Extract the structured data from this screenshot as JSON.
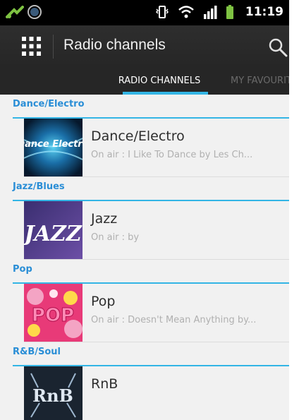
{
  "status_bar": {
    "time": "11:19",
    "icons": [
      "usb-debug-icon",
      "clock-icon",
      "vibrate-icon",
      "wifi-icon",
      "signal-icon",
      "battery-icon"
    ]
  },
  "action_bar": {
    "title": "Radio channels",
    "icons": [
      "app-grid-icon",
      "search-icon"
    ]
  },
  "tabs": [
    {
      "label": "RADIO CHANNELS",
      "selected": true
    },
    {
      "label": "MY FAVOURITES",
      "selected": false
    }
  ],
  "colors": {
    "accent": "#33b5e5",
    "section_text": "#2a8ed6",
    "actionbar": "#2b2b2b",
    "list_bg": "#f1f1f1"
  },
  "sections": [
    {
      "header": "Dance/Electro",
      "channel": {
        "name": "Dance/Electro",
        "on_air": "On air : I Like To Dance by Les Ch...",
        "thumb_text": "Dance Electro"
      }
    },
    {
      "header": "Jazz/Blues",
      "channel": {
        "name": "Jazz",
        "on_air": "On air :  by",
        "thumb_text": "JAZZ"
      }
    },
    {
      "header": "Pop",
      "channel": {
        "name": "Pop",
        "on_air": "On air : Doesn't Mean Anything by...",
        "thumb_text": "POP"
      }
    },
    {
      "header": "R&B/Soul",
      "channel": {
        "name": "RnB",
        "on_air": "",
        "thumb_text": "RnB"
      }
    }
  ]
}
